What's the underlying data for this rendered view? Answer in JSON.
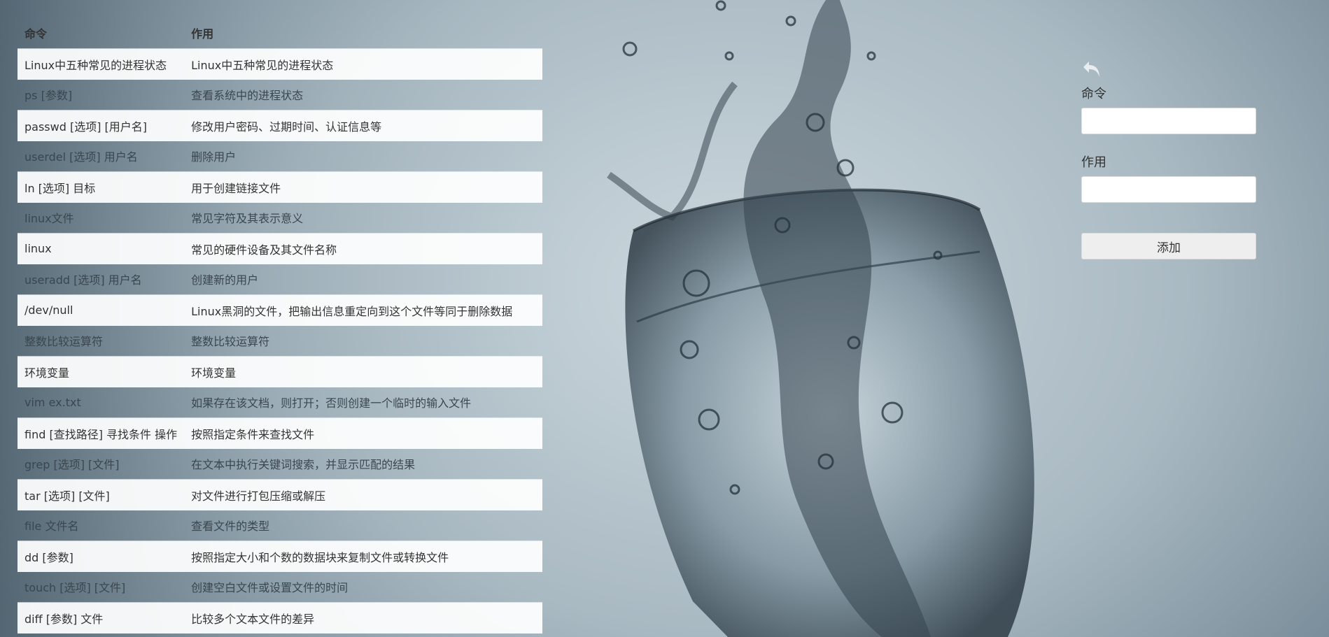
{
  "table": {
    "headers": [
      "命令",
      "作用"
    ],
    "rows": [
      {
        "cmd": "Linux中五种常见的进程状态",
        "desc": "Linux中五种常见的进程状态"
      },
      {
        "cmd": "ps [参数]",
        "desc": "查看系统中的进程状态"
      },
      {
        "cmd": "passwd [选项] [用户名]",
        "desc": "修改用户密码、过期时间、认证信息等"
      },
      {
        "cmd": "userdel [选项] 用户名",
        "desc": "删除用户"
      },
      {
        "cmd": "ln [选项] 目标",
        "desc": "用于创建链接文件"
      },
      {
        "cmd": "linux文件",
        "desc": "常见字符及其表示意义"
      },
      {
        "cmd": "linux",
        "desc": "常见的硬件设备及其文件名称"
      },
      {
        "cmd": "useradd [选项] 用户名",
        "desc": "创建新的用户"
      },
      {
        "cmd": "/dev/null",
        "desc": "Linux黑洞的文件，把输出信息重定向到这个文件等同于删除数据"
      },
      {
        "cmd": "整数比较运算符",
        "desc": "整数比较运算符"
      },
      {
        "cmd": "环境变量",
        "desc": "环境变量"
      },
      {
        "cmd": "vim ex.txt",
        "desc": "如果存在该文档，则打开；否则创建一个临时的输入文件"
      },
      {
        "cmd": "find [查找路径] 寻找条件 操作",
        "desc": "按照指定条件来查找文件"
      },
      {
        "cmd": "grep [选项] [文件]",
        "desc": "在文本中执行关键词搜索，并显示匹配的结果"
      },
      {
        "cmd": "tar [选项] [文件]",
        "desc": "对文件进行打包压缩或解压"
      },
      {
        "cmd": "file 文件名",
        "desc": "查看文件的类型"
      },
      {
        "cmd": "dd [参数]",
        "desc": "按照指定大小和个数的数据块来复制文件或转换文件"
      },
      {
        "cmd": "touch [选项] [文件]",
        "desc": "创建空白文件或设置文件的时间"
      },
      {
        "cmd": "diff [参数] 文件",
        "desc": "比较多个文本文件的差异"
      }
    ]
  },
  "form": {
    "back_icon": "undo-arrow-icon",
    "command_label": "命令",
    "command_value": "",
    "usage_label": "作用",
    "usage_value": "",
    "add_label": "添加"
  }
}
